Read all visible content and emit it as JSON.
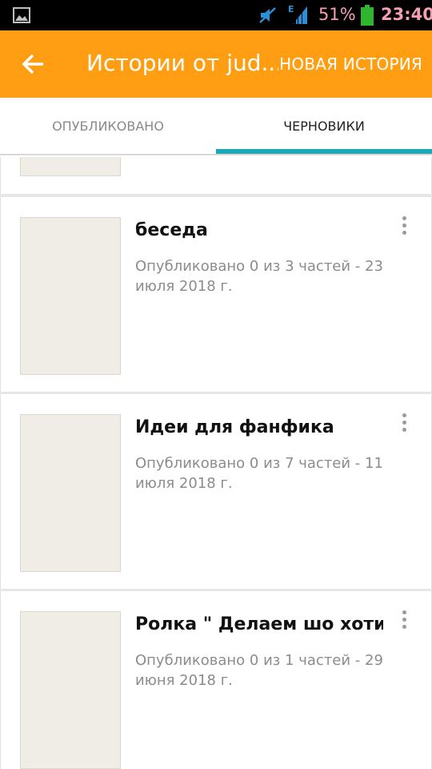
{
  "status_bar": {
    "battery_percent": "51%",
    "time": "23:40",
    "network_type": "E",
    "icons": [
      "gallery-icon",
      "mute-icon",
      "signal-icon",
      "battery-icon"
    ],
    "colors": {
      "text": "#f4a0b2",
      "battery": "#2fb52f"
    }
  },
  "app_bar": {
    "title": "Истории от jud...",
    "action_label": "НОВАЯ ИСТОРИЯ",
    "back_icon": "arrow-left-icon",
    "color": "#ff9e12"
  },
  "tabs": [
    {
      "label": "ОПУБЛИКОВАНО",
      "active": false
    },
    {
      "label": "ЧЕРНОВИКИ",
      "active": true
    }
  ],
  "tab_indicator_color": "#1ea7b5",
  "stories": [
    {
      "title": "беседа",
      "meta": "Опубликовано 0 из 3 частей - 23 июля 2018 г."
    },
    {
      "title": "Идеи для фанфика",
      "meta": "Опубликовано 0 из 7 частей - 11 июля 2018 г."
    },
    {
      "title": "Ролка \" Делаем шо хотим",
      "meta": "Опубликовано 0 из 1 частей - 29 июня 2018 г."
    }
  ]
}
